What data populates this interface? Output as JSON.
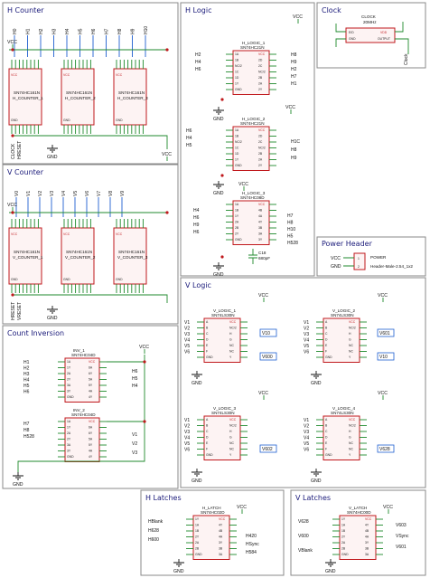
{
  "panels": {
    "h_counter": "H Counter",
    "h_logic": "H Logic",
    "clock": "Clock",
    "v_counter": "V Counter",
    "power_header": "Power Header",
    "v_logic": "V Logic",
    "count_inversion": "Count Inversion",
    "h_latches": "H Latches",
    "v_latches": "V Latches"
  },
  "h_counter": {
    "chips": [
      {
        "part": "SN74HC161N",
        "ref": "H_COUNTER_1"
      },
      {
        "part": "SN74HC161N",
        "ref": "H_COUNTER_2"
      },
      {
        "part": "SN74HC161N",
        "ref": "H_COUNTER_3"
      }
    ],
    "top_nets": [
      "H0",
      "H1",
      "H2",
      "H3",
      "H4",
      "H5",
      "H6",
      "H7",
      "H8",
      "H9",
      "H10"
    ],
    "bottom_nets": [
      "CLOCK",
      "HRESET"
    ]
  },
  "v_counter": {
    "chips": [
      {
        "part": "SN74HC161N",
        "ref": "V_COUNTER_1"
      },
      {
        "part": "SN74HC161N",
        "ref": "V_COUNTER_2"
      },
      {
        "part": "SN74HC161N",
        "ref": "V_COUNTER_3"
      }
    ],
    "top_nets": [
      "V0",
      "V1",
      "V2",
      "V3",
      "V4",
      "V5",
      "V6",
      "V7",
      "V8",
      "V9"
    ],
    "bottom_nets": [
      "HRESET",
      "VRESET"
    ]
  },
  "h_logic": {
    "chips": [
      {
        "ref": "H_LOGIC_1",
        "part": "SN74HC21N"
      },
      {
        "ref": "H_LOGIC_2",
        "part": "SN74HC21N"
      },
      {
        "ref": "H_LOGIC_3",
        "part": "SN74HC08D"
      }
    ],
    "cap": {
      "ref": "C18",
      "value": "680pF"
    },
    "nets_left_1": [
      "H2",
      "H4",
      "H6"
    ],
    "nets_right_1": [
      "H8",
      "H9",
      "H2",
      "H7",
      "H1"
    ],
    "nets_left_2": [
      "H6",
      "H4",
      "H5"
    ],
    "nets_right_2": [
      "H1C",
      "H8",
      "H9"
    ],
    "nets_left_3": [
      "H4",
      "H6",
      "H9",
      "H6"
    ],
    "nets_right_3": [
      "H7",
      "H8",
      "H10",
      "H5",
      "H528"
    ]
  },
  "clock": {
    "title": "CLOCK",
    "freq": "20MHz",
    "pin_left": "E/D",
    "pin_gnd": "GND",
    "pin_vdd": "VDD",
    "pin_out": "OUTPUT",
    "net": "Clock"
  },
  "power_header": {
    "pin1": "1",
    "pin2": "2",
    "label": "POWER",
    "part": "Header-Male-2.54_1x2"
  },
  "count_inversion": {
    "chips": [
      {
        "ref": "INV_1",
        "part": "SN74HC04D"
      },
      {
        "ref": "INV_2",
        "part": "SN74HC04D"
      }
    ],
    "nets_left_1": [
      "H1",
      "H2",
      "H3",
      "H4",
      "H5",
      "H6"
    ],
    "nets_right_1": [
      "H6",
      "H5",
      "H4"
    ],
    "nets_left_2": [
      "H7",
      "H8",
      "H528"
    ],
    "nets_right_2": [
      "V1",
      "V2",
      "V3"
    ]
  },
  "v_logic": {
    "chips": [
      {
        "ref": "V_LOGIC_1",
        "part": "SN74LS30N"
      },
      {
        "ref": "V_LOGIC_2",
        "part": "SN74LS30N"
      },
      {
        "ref": "V_LOGIC_3",
        "part": "SN74LS30N"
      },
      {
        "ref": "V_LOGIC_4",
        "part": "SN74LS30N"
      }
    ],
    "outputs": [
      "V10",
      "V600",
      "V601",
      "V10",
      "V602",
      "V628"
    ]
  },
  "h_latches": {
    "chip": {
      "ref": "H_LATCH",
      "part": "SN74HC02D"
    },
    "nets_left": [
      "HBlank",
      "H628",
      "H600"
    ],
    "nets_right": [
      "H420",
      "HSync",
      "H584"
    ]
  },
  "v_latches": {
    "chip": {
      "ref": "V_LATCH",
      "part": "SN74HC00D"
    },
    "nets_left": [
      "V628",
      "V600",
      "VBlank"
    ],
    "nets_right": [
      "V603",
      "VSync",
      "V601"
    ]
  },
  "power": {
    "vcc": "VCC",
    "gnd": "GND"
  },
  "pin_labels": {
    "counter_left": [
      "CLR",
      "CLK",
      "A",
      "B",
      "C",
      "D",
      "ENP",
      "GND"
    ],
    "counter_right": [
      "VCC",
      "RCO",
      "QA",
      "QB",
      "QC",
      "QD",
      "ENT",
      "LOAD"
    ],
    "and4_left": [
      "1A",
      "1B",
      "NC/2",
      "1C",
      "1D",
      "1Y",
      "GND"
    ],
    "and4_right": [
      "VCC",
      "2D",
      "2C",
      "NC/2",
      "2B",
      "2A",
      "2Y"
    ],
    "and2_left": [
      "1A",
      "1B",
      "1Y",
      "2A",
      "2B",
      "2Y",
      "GND"
    ],
    "and2_right": [
      "VCC",
      "4B",
      "4A",
      "4Y",
      "3B",
      "3A",
      "3Y"
    ],
    "nand8_left": [
      "A",
      "B",
      "C",
      "D",
      "E",
      "F",
      "GND"
    ],
    "nand8_right": [
      "VCC",
      "NC/2",
      "H",
      "G",
      "NC",
      "NC",
      "Y"
    ],
    "inv_left": [
      "1A",
      "1Y",
      "2A",
      "2Y",
      "3A",
      "3Y",
      "GND"
    ],
    "inv_right": [
      "VCC",
      "6A",
      "6Y",
      "5A",
      "5Y",
      "4A",
      "4Y"
    ],
    "nor_left": [
      "1Y",
      "1A",
      "1B",
      "2Y",
      "2A",
      "2B",
      "GND"
    ],
    "nor_right": [
      "VCC",
      "4Y",
      "4B",
      "4A",
      "3Y",
      "3B",
      "3A"
    ]
  }
}
